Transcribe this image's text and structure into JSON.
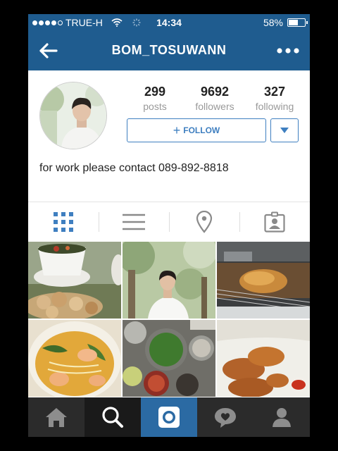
{
  "status_bar": {
    "carrier": "TRUE-H",
    "time": "14:34",
    "battery": "58%",
    "battery_level": 0.58
  },
  "nav": {
    "title": "BOM_TOSUWANN",
    "back_icon": "back-arrow-icon",
    "more_icon": "more-dots-icon"
  },
  "profile": {
    "stats": [
      {
        "value": "299",
        "label": "posts"
      },
      {
        "value": "9692",
        "label": "followers"
      },
      {
        "value": "327",
        "label": "following"
      }
    ],
    "follow_label": "FOLLOW",
    "bio": "for work please contact 089-892-8818"
  },
  "tabs": [
    {
      "name": "grid-view",
      "icon": "grid-icon",
      "active": true
    },
    {
      "name": "list-view",
      "icon": "list-icon",
      "active": false
    },
    {
      "name": "map-view",
      "icon": "location-pin-icon",
      "active": false
    },
    {
      "name": "tagged-photos",
      "icon": "tagged-person-icon",
      "active": false
    }
  ],
  "photos": [
    {
      "subject": "noodle bowl and fried pork rinds"
    },
    {
      "subject": "portrait among trees"
    },
    {
      "subject": "roast chicken in oven"
    },
    {
      "subject": "curry noodle soup with shrimp"
    },
    {
      "subject": "market vegetables in bowls"
    },
    {
      "subject": "fried chicken wings with dipping sauce"
    }
  ],
  "bottom_tabs": [
    {
      "name": "home",
      "icon": "home-icon"
    },
    {
      "name": "explore",
      "icon": "search-icon"
    },
    {
      "name": "camera",
      "icon": "camera-icon"
    },
    {
      "name": "activity",
      "icon": "activity-bubble-icon"
    },
    {
      "name": "profile",
      "icon": "profile-icon"
    }
  ],
  "colors": {
    "header": "#1f5c8f",
    "accent": "#3f7fc0",
    "tabbar": "#2b2b2b",
    "camera_tab": "#2b6aa3"
  }
}
